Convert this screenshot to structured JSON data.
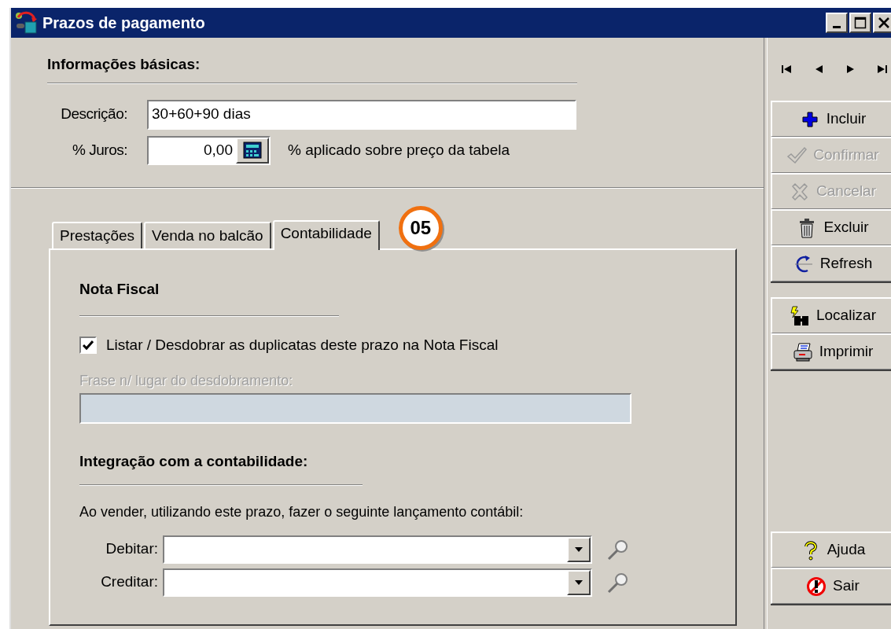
{
  "window": {
    "title": "Prazos de pagamento"
  },
  "basic_info": {
    "heading": "Informações básicas:",
    "fields": [
      {
        "label": "Descrição:",
        "value": "30+60+90 dias",
        "kind": "text"
      },
      {
        "label": "% Juros:",
        "value": "0,00",
        "kind": "calc",
        "note": "% aplicado sobre preço da tabela"
      }
    ]
  },
  "tabs": [
    {
      "label": "Prestações",
      "selected": false
    },
    {
      "label": "Venda no balcão",
      "selected": false
    },
    {
      "label": "Contabilidade",
      "selected": true
    }
  ],
  "callout": "05",
  "nota_fiscal": {
    "heading": "Nota Fiscal",
    "checkbox": {
      "label": "Listar / Desdobrar as duplicatas deste prazo na Nota Fiscal",
      "checked": true
    },
    "phrase_field": {
      "label": "Frase n/ lugar do desdobramento:",
      "disabled": true
    }
  },
  "integration": {
    "heading": "Integração com a contabilidade:",
    "intro": "Ao vender, utilizando este prazo, fazer o seguinte lançamento contábil:",
    "accounts": [
      {
        "label": "Debitar:"
      },
      {
        "label": "Creditar:"
      }
    ]
  },
  "toolbar": {
    "groups": [
      {
        "buttons": [
          {
            "label": "Incluir",
            "kind": "add",
            "disabled": false
          },
          {
            "label": "Confirmar",
            "kind": "confirm",
            "disabled": true
          },
          {
            "label": "Cancelar",
            "kind": "cancel",
            "disabled": true
          },
          {
            "label": "Excluir",
            "kind": "delete",
            "disabled": false
          },
          {
            "label": "Refresh",
            "kind": "refresh",
            "disabled": false
          }
        ]
      },
      {
        "buttons": [
          {
            "label": "Localizar",
            "kind": "find",
            "disabled": false
          },
          {
            "label": "Imprimir",
            "kind": "print",
            "disabled": false
          }
        ]
      },
      {
        "buttons": [
          {
            "label": "Ajuda",
            "kind": "help",
            "disabled": false
          },
          {
            "label": "Sair",
            "kind": "exit",
            "disabled": false
          }
        ]
      }
    ]
  }
}
